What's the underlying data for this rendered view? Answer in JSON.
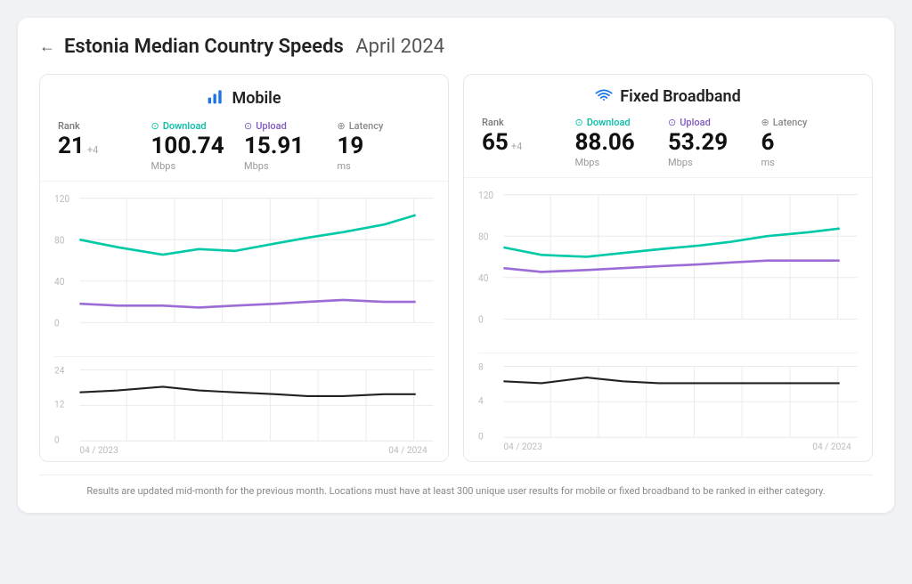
{
  "page": {
    "back_label": "←",
    "title": "Estonia Median Country Speeds",
    "title_date": "April 2024"
  },
  "mobile": {
    "panel_title": "Mobile",
    "panel_icon": "📶",
    "rank_label": "Rank",
    "rank_value": "21",
    "rank_change": "+4",
    "download_label": "Download",
    "download_value": "100.74",
    "download_unit": "Mbps",
    "upload_label": "Upload",
    "upload_value": "15.91",
    "upload_unit": "Mbps",
    "latency_label": "Latency",
    "latency_value": "19",
    "latency_unit": "ms"
  },
  "broadband": {
    "panel_title": "Fixed Broadband",
    "panel_icon": "📡",
    "rank_label": "Rank",
    "rank_value": "65",
    "rank_change": "+4",
    "download_label": "Download",
    "download_value": "88.06",
    "download_unit": "Mbps",
    "upload_label": "Upload",
    "upload_value": "53.29",
    "upload_unit": "Mbps",
    "latency_label": "Latency",
    "latency_value": "6",
    "latency_unit": "ms"
  },
  "footer": {
    "note": "Results are updated mid-month for the previous month. Locations must have at least 300 unique user results for mobile or fixed broadband to be ranked in either category."
  },
  "charts": {
    "x_start": "04 / 2023",
    "x_end": "04 / 2024"
  }
}
